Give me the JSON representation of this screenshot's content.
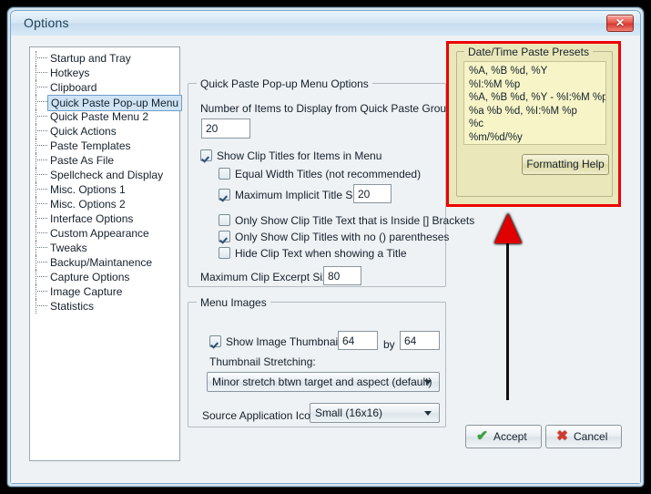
{
  "window": {
    "title": "Options",
    "close_label": "✕"
  },
  "sidebar": {
    "items": [
      {
        "label": "Startup and Tray",
        "selected": false
      },
      {
        "label": "Hotkeys",
        "selected": false
      },
      {
        "label": "Clipboard",
        "selected": false
      },
      {
        "label": "Quick Paste Pop-up Menu",
        "selected": true
      },
      {
        "label": "Quick Paste Menu 2",
        "selected": false
      },
      {
        "label": "Quick Actions",
        "selected": false
      },
      {
        "label": "Paste Templates",
        "selected": false
      },
      {
        "label": "Paste As File",
        "selected": false
      },
      {
        "label": "Spellcheck and Display",
        "selected": false
      },
      {
        "label": "Misc. Options 1",
        "selected": false
      },
      {
        "label": "Misc. Options 2",
        "selected": false
      },
      {
        "label": "Interface Options",
        "selected": false
      },
      {
        "label": "Custom Appearance",
        "selected": false
      },
      {
        "label": "Tweaks",
        "selected": false
      },
      {
        "label": "Backup/Maintanence",
        "selected": false
      },
      {
        "label": "Capture Options",
        "selected": false
      },
      {
        "label": "Image Capture",
        "selected": false
      },
      {
        "label": "Statistics",
        "selected": false
      }
    ]
  },
  "quick_paste_group": {
    "legend": "Quick Paste Pop-up Menu Options",
    "number_items_label": "Number of Items to Display from Quick Paste Group:",
    "number_items_value": "20",
    "show_clip_titles_label": "Show Clip Titles for Items in Menu",
    "show_clip_titles_checked": true,
    "equal_width_label": "Equal Width Titles (not recommended)",
    "equal_width_checked": false,
    "max_implicit_label": "Maximum Implicit Title Size:",
    "max_implicit_checked": true,
    "max_implicit_value": "20",
    "brackets_label": "Only Show Clip Title Text that is Inside [] Brackets",
    "brackets_checked": false,
    "parens_label": "Only Show Clip Titles with no () parentheses",
    "parens_checked": true,
    "hide_clip_text_label": "Hide Clip Text when showing a Title",
    "hide_clip_text_checked": false,
    "max_excerpt_label": "Maximum Clip Excerpt Size:",
    "max_excerpt_value": "80"
  },
  "menu_images_group": {
    "legend": "Menu Images",
    "show_thumbnails_label": "Show Image Thumbnails:",
    "show_thumbnails_checked": true,
    "thumb_width": "64",
    "by_label": "by",
    "thumb_height": "64",
    "stretching_label": "Thumbnail Stretching:",
    "stretching_value": "Minor stretch btwn target and aspect (default)",
    "source_icons_label": "Source Application Icons:",
    "source_icons_value": "Small (16x16)"
  },
  "datetime_presets": {
    "legend": "Date/Time Paste Presets",
    "presets": [
      "%A, %B %d, %Y",
      "%I:%M %p",
      "%A, %B %d, %Y - %I:%M %p",
      "%a %b %d, %I:%M %p",
      "%c",
      "%m/%d/%y"
    ],
    "formatting_help_label": "Formatting Help",
    "highlight_color": "#ee0000"
  },
  "footer": {
    "accept_label": "Accept",
    "accept_glyph": "✔",
    "cancel_label": "Cancel",
    "cancel_glyph": "✖"
  },
  "annotation": {
    "arrow_color": "#e00000"
  }
}
